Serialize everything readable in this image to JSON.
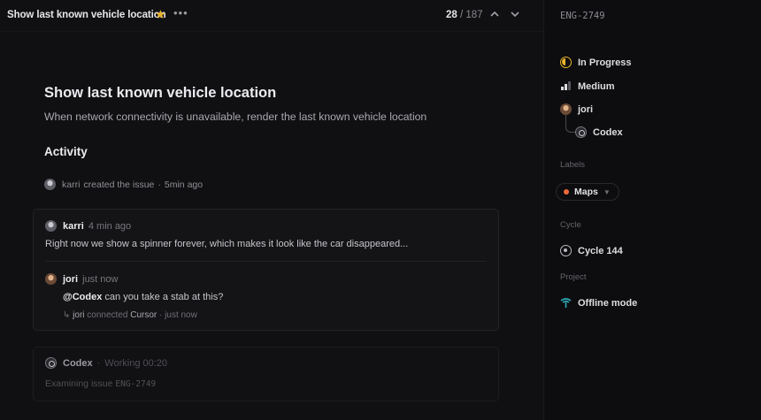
{
  "header": {
    "title": "Show last known vehicle location",
    "star_icon": "star-icon",
    "more_icon": "more-icon",
    "pager_current": "28",
    "pager_total": "/ 187"
  },
  "issue": {
    "id": "ENG-2749",
    "title": "Show last known vehicle location",
    "description": "When network connectivity is unavailable, render the last known vehicle location"
  },
  "activity": {
    "heading": "Activity",
    "event": {
      "user": "karri",
      "text": "created the issue",
      "sep": "·",
      "time": "5min ago"
    },
    "comment": {
      "author": "karri",
      "time": "4 min ago",
      "text": "Right now we show a spinner forever, which makes it look like the car disappeared...",
      "reply": {
        "author": "jori",
        "time": "just now",
        "mention": "@Codex",
        "text": " can you take a stab at this?",
        "connect_arrow": "↳",
        "connect_user": "jori",
        "connect_text": "connected",
        "connect_target": "Cursor",
        "connect_sep": "·",
        "connect_time": "just now"
      }
    },
    "agent": {
      "name": "Codex",
      "sep": "·",
      "status": "Working 00:20",
      "sub_text": "Examining issue",
      "sub_id": "ENG-2749"
    }
  },
  "sidebar": {
    "issue_id": "ENG-2749",
    "status": "In Progress",
    "priority": "Medium",
    "assignee": "jori",
    "delegate": "Codex",
    "labels_heading": "Labels",
    "label": "Maps",
    "label_color": "#ef6a3a",
    "cycle_heading": "Cycle",
    "cycle": "Cycle 144",
    "project_heading": "Project",
    "project": "Offline mode",
    "status_color": "#e8b229",
    "project_color": "#2ea8b8"
  }
}
